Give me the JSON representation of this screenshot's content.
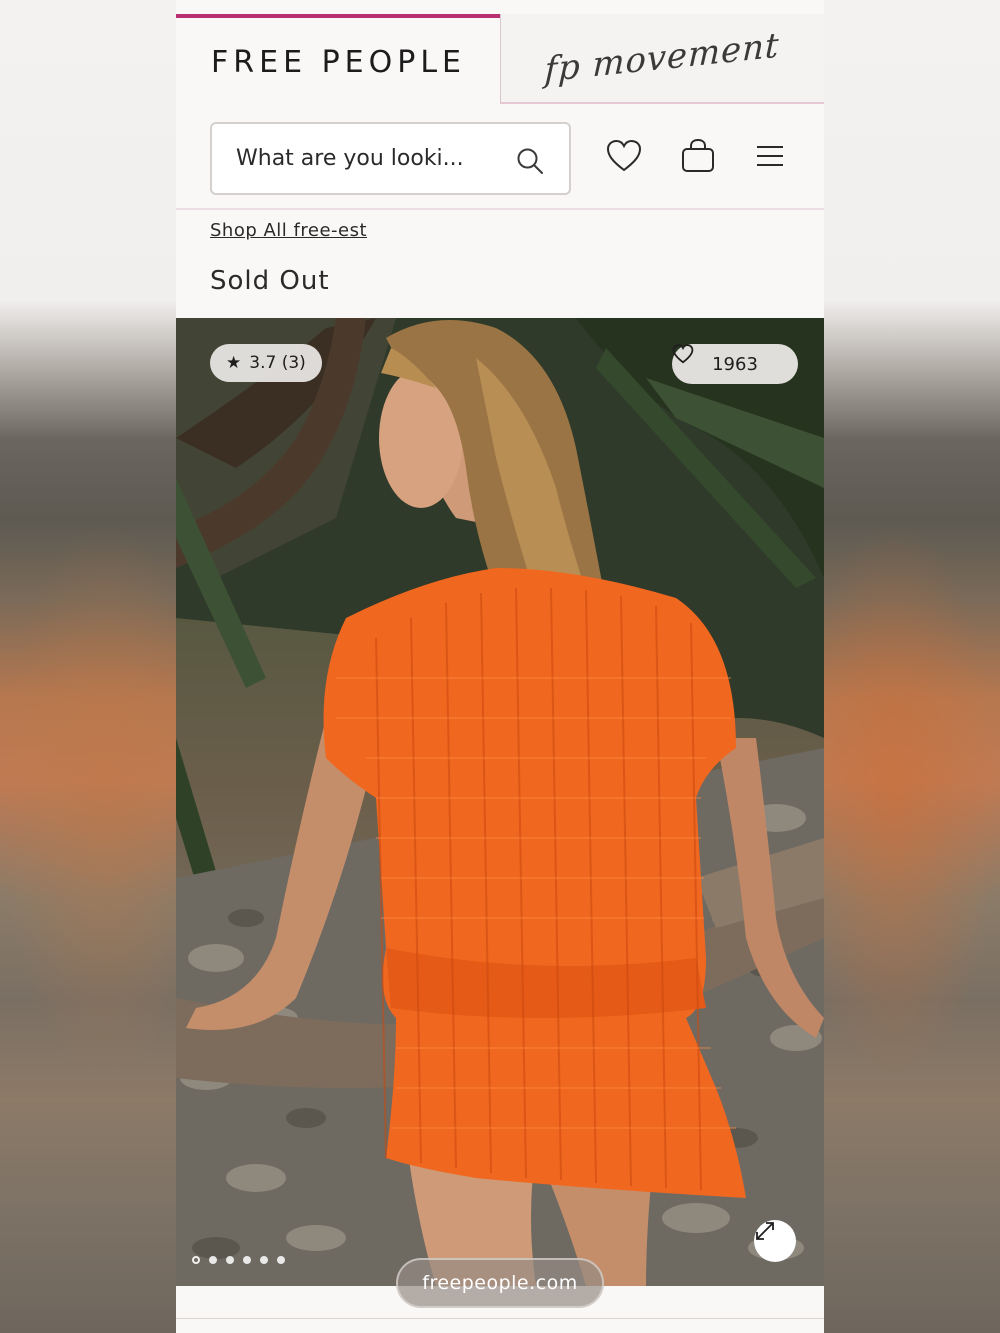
{
  "brand_tabs": {
    "free_people": "FREE PEOPLE",
    "fp_movement": "fp movement"
  },
  "search": {
    "placeholder": "What are you looki..."
  },
  "header_icons": [
    "search-icon",
    "heart-icon",
    "shopping-bag-icon",
    "hamburger-menu-icon"
  ],
  "breadcrumb": {
    "link": "Shop All free-est"
  },
  "product": {
    "status": "Sold Out",
    "rating": {
      "star": "★",
      "text": "3.7 (3)"
    },
    "likes": "1963",
    "image_description_colors": {
      "garment": "#f0671f",
      "accent": "#b8306f"
    },
    "carousel": {
      "total_slides": 6,
      "active_index": 0
    }
  },
  "browser": {
    "url": "freepeople.com"
  }
}
